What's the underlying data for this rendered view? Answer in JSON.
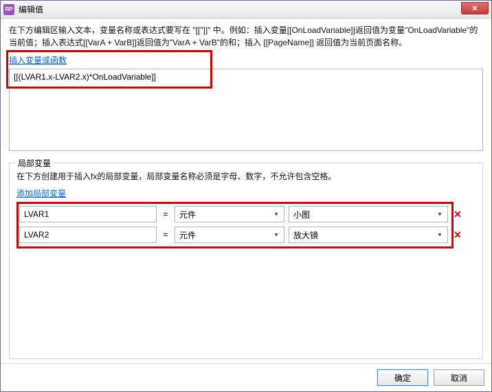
{
  "titlebar": {
    "app_icon_text": "RP",
    "title": "编辑值",
    "close_glyph": "✕"
  },
  "top": {
    "help_text": "在下方编辑区输入文本，变量名称或表达式要写在 \"[[\"]]\" 中。例如：插入变量[[OnLoadVariable]]返回值为变量\"OnLoadVariable\"的当前值；插入表达式[[VarA + VarB]]返回值为\"VarA + VarB\"的和；插入 [[PageName]] 返回值为当前页面名称。",
    "insert_link": "插入变量或函数",
    "expression_value": "[[(LVAR1.x-LVAR2.x)*OnLoadVariable]]"
  },
  "local": {
    "legend": "局部变量",
    "help_text": "在下方创建用于插入fx的局部变量，局部变量名称必须是字母、数字，不允许包含空格。",
    "add_link": "添加局部变量",
    "eq_label": "=",
    "rows": [
      {
        "name": "LVAR1",
        "type": "元件",
        "target": "小图"
      },
      {
        "name": "LVAR2",
        "type": "元件",
        "target": "放大镜"
      }
    ],
    "dropdown_glyph": "▾",
    "delete_glyph": "✕"
  },
  "footer": {
    "ok": "确定",
    "cancel": "取消"
  }
}
